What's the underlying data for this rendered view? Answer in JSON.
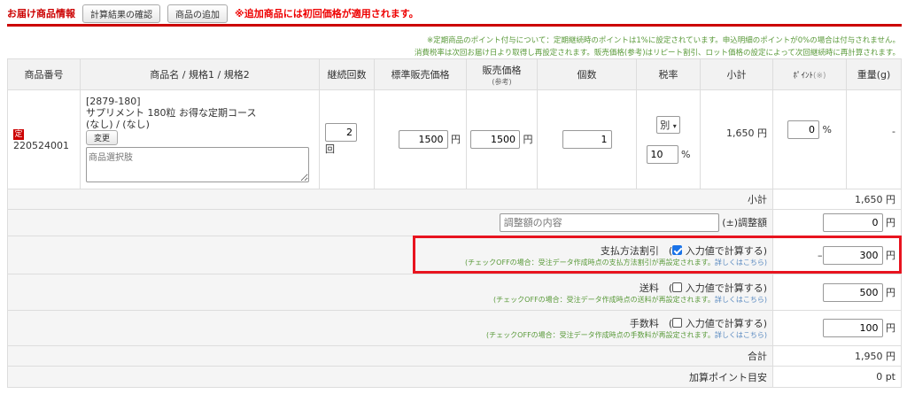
{
  "header": {
    "title": "お届け商品情報",
    "confirm_button": "計算結果の確認",
    "add_button": "商品の追加",
    "warning": "※追加商品には初回価格が適用されます。"
  },
  "notes": [
    "※定期商品のポイント付与について：定期継続時のポイントは1%に設定されています。申込明細のポイントが0%の場合は付与されません。",
    "消費税率は次回お届け日より取得し再設定されます。販売価格(参考)はリピート割引、ロット価格の設定によって次回継続時に再計算されます。"
  ],
  "columns": {
    "code": "商品番号",
    "name": "商品名 / 規格1 / 規格2",
    "count": "継続回数",
    "std_price": "標準販売価格",
    "price": "販売価格",
    "price_sub": "(参考)",
    "qty": "個数",
    "tax": "税率",
    "subtotal": "小計",
    "point": "ﾎﾟｲﾝﾄ",
    "point_sub": "(※)",
    "weight": "重量(g)"
  },
  "item": {
    "badge": "定",
    "code": "220524001",
    "sku": "[2879-180]",
    "name": "サプリメント 180粒 お得な定期コース",
    "spec": "(なし) / (なし)",
    "change_button": "変更",
    "option_placeholder": "商品選択肢",
    "count": "2",
    "count_unit": "回",
    "std_price": "1500",
    "price": "1500",
    "yen": "円",
    "qty": "1",
    "tax_type": "別",
    "tax_rate": "10",
    "percent": "%",
    "subtotal": "1,650 円",
    "point": "0",
    "weight": "-"
  },
  "summary": {
    "subtotal_label": "小計",
    "subtotal_value": "1,650 円",
    "adjust_placeholder": "調整額の内容",
    "adjust_label": "(±)調整額",
    "adjust_value": "0",
    "payment_label": "支払方法割引　(",
    "calc_label": "入力値で計算する)",
    "payment_checked": true,
    "payment_note": "(チェックOFFの場合：受注データ作成時点の支払方法割引が再設定されます。",
    "detail_link": "詳しくはこちら)",
    "payment_minus": "–",
    "payment_value": "300",
    "shipping_label": "送料　(",
    "shipping_checked": false,
    "shipping_note": "(チェックOFFの場合：受注データ作成時点の送料が再設定されます。",
    "shipping_value": "500",
    "fee_label": "手数料　(",
    "fee_checked": false,
    "fee_note": "(チェックOFFの場合：受注データ作成時点の手数料が再設定されます。",
    "fee_value": "100",
    "total_label": "合計",
    "total_value": "1,950 円",
    "points_label": "加算ポイント目安",
    "points_value": "0 pt",
    "yen": "円"
  }
}
